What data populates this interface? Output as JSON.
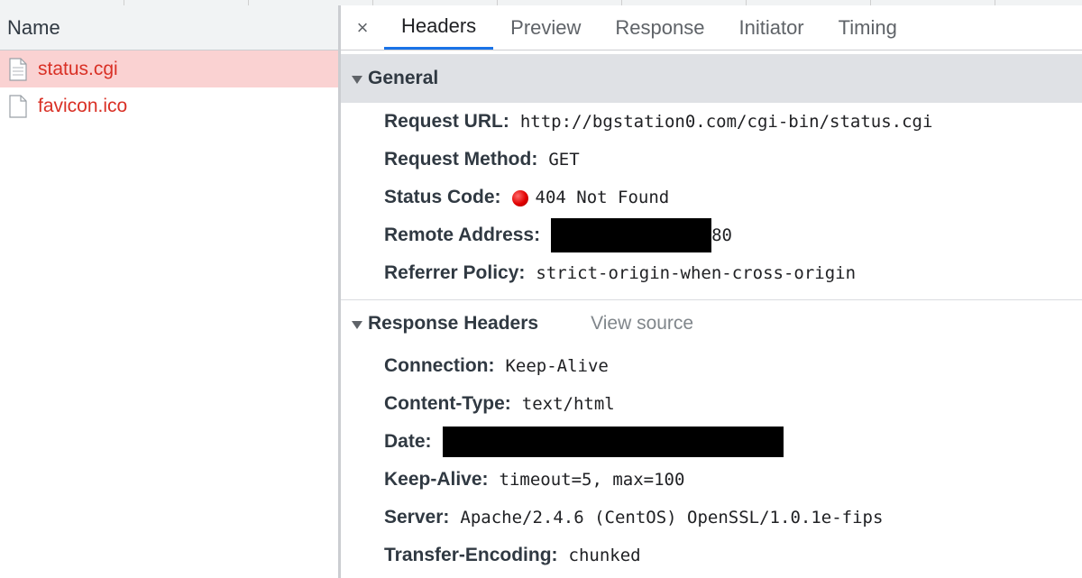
{
  "requests": {
    "column_header": "Name",
    "items": [
      {
        "name": "status.cgi",
        "selected": true
      },
      {
        "name": "favicon.ico",
        "selected": false
      }
    ]
  },
  "tabs": {
    "close_label": "×",
    "items": [
      "Headers",
      "Preview",
      "Response",
      "Initiator",
      "Timing"
    ],
    "active": "Headers"
  },
  "general": {
    "title": "General",
    "request_url_label": "Request URL:",
    "request_url": "http://bgstation0.com/cgi-bin/status.cgi",
    "request_method_label": "Request Method:",
    "request_method": "GET",
    "status_code_label": "Status Code:",
    "status_code": "404 Not Found",
    "remote_address_label": "Remote Address:",
    "remote_address_port": "80",
    "referrer_policy_label": "Referrer Policy:",
    "referrer_policy": "strict-origin-when-cross-origin"
  },
  "response_headers": {
    "title": "Response Headers",
    "view_source": "View source",
    "connection_label": "Connection:",
    "connection": "Keep-Alive",
    "content_type_label": "Content-Type:",
    "content_type": "text/html",
    "date_label": "Date:",
    "keep_alive_label": "Keep-Alive:",
    "keep_alive": "timeout=5, max=100",
    "server_label": "Server:",
    "server": "Apache/2.4.6 (CentOS) OpenSSL/1.0.1e-fips",
    "transfer_encoding_label": "Transfer-Encoding:",
    "transfer_encoding": "chunked"
  },
  "colors": {
    "selected_row": "#fad2d2",
    "request_text": "#d93025",
    "active_tab_underline": "#1a73e8",
    "status_error": "#e00000"
  }
}
